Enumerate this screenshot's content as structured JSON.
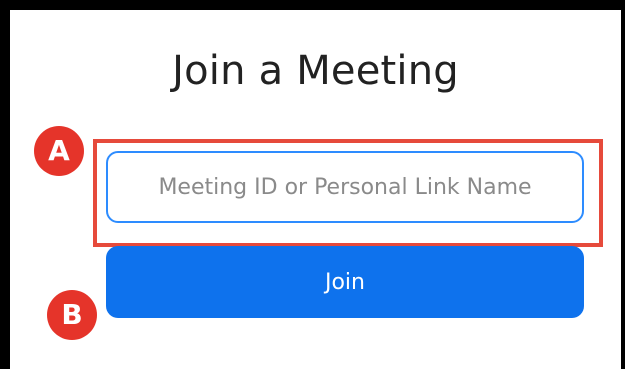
{
  "dialog": {
    "title": "Join a Meeting",
    "meeting_input": {
      "value": "",
      "placeholder": "Meeting ID or Personal Link Name"
    },
    "join_label": "Join"
  },
  "annotations": {
    "marker_a": "A",
    "marker_b": "B"
  },
  "colors": {
    "primary_button": "#0e72ed",
    "input_border": "#2d8cff",
    "highlight": "#e64a3b",
    "marker": "#e5342a"
  }
}
